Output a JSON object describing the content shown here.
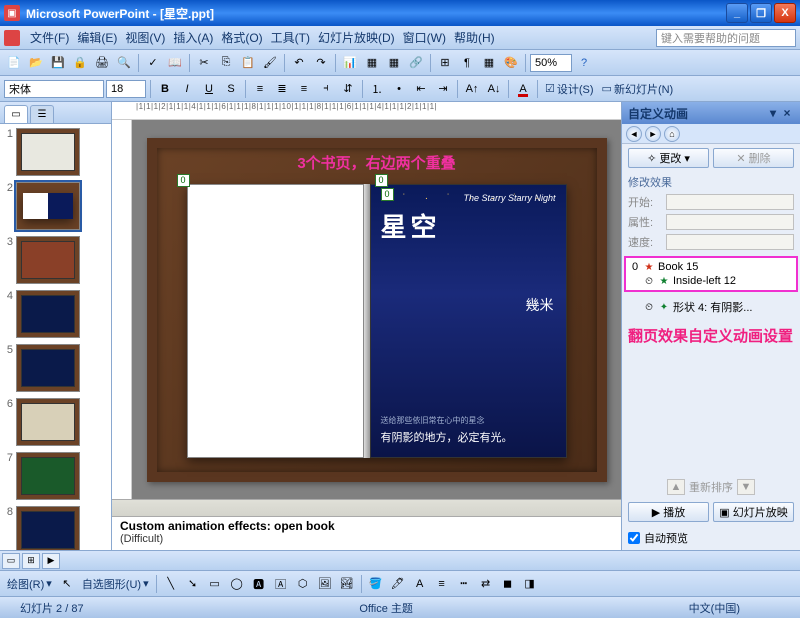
{
  "window": {
    "app": "Microsoft PowerPoint",
    "doc": "[星空.ppt]",
    "min": "_",
    "max": "❐",
    "close": "X"
  },
  "menu": {
    "file": "文件(F)",
    "edit": "编辑(E)",
    "view": "视图(V)",
    "insert": "插入(A)",
    "format": "格式(O)",
    "tools": "工具(T)",
    "slideshow": "幻灯片放映(D)",
    "window": "窗口(W)",
    "help": "帮助(H)",
    "help_placeholder": "键入需要帮助的问题"
  },
  "toolbar1": {
    "zoom": "50%"
  },
  "toolbar2": {
    "font": "宋体",
    "size": "18",
    "bold": "B",
    "italic": "I",
    "underline": "U",
    "shadow": "S",
    "design": "设计(S)",
    "newslide": "新幻灯片(N)"
  },
  "ruler": "|1|1|1|2|1|1|1|4|1|1|1|6|1|1|1|8|1|1|1|10|1|1|1|8|1|1|1|6|1|1|1|4|1|1|1|2|1|1|1|",
  "thumbnails": {
    "tabs": {
      "t1": "▭",
      "t2": "☰"
    },
    "items": [
      {
        "num": "1"
      },
      {
        "num": "2"
      },
      {
        "num": "3"
      },
      {
        "num": "4"
      },
      {
        "num": "5"
      },
      {
        "num": "6"
      },
      {
        "num": "7"
      },
      {
        "num": "8"
      }
    ]
  },
  "slide": {
    "annotation": "3个书页，右边两个重叠",
    "handle": "0",
    "book_en": "The Starry Starry Night",
    "book_cn": "星空",
    "book_author": "幾米",
    "book_tag": "送给那些依旧常在心中的星念",
    "book_bottom": "有阴影的地方，必定有光。"
  },
  "notes": {
    "line1": "Custom animation effects: open book",
    "line2": "(Difficult)"
  },
  "taskpane": {
    "title": "自定义动画",
    "add": "更改",
    "remove": "删除",
    "section_modify": "修改效果",
    "start_label": "开始:",
    "prop_label": "属性:",
    "speed_label": "速度:",
    "anim": [
      {
        "idx": "0",
        "icon": "★",
        "color": "#d03018",
        "name": "Book 15"
      },
      {
        "idx": "",
        "icon": "★",
        "color": "#108030",
        "name": "Inside-left 12",
        "pre": "⏲"
      },
      {
        "idx": "",
        "icon": "✦",
        "color": "#108030",
        "name": "形状 4: 有阴影...",
        "pre": "⏲"
      }
    ],
    "annotation": "翻页效果自定义动画设置",
    "reorder": "重新排序",
    "play": "播放",
    "slideshow": "幻灯片放映",
    "autopreview": "自动预览"
  },
  "drawbar": {
    "draw": "绘图(R)",
    "autoshape": "自选图形(U)"
  },
  "status": {
    "slide": "幻灯片 2 / 87",
    "theme": "Office 主题",
    "lang": "中文(中国)"
  }
}
